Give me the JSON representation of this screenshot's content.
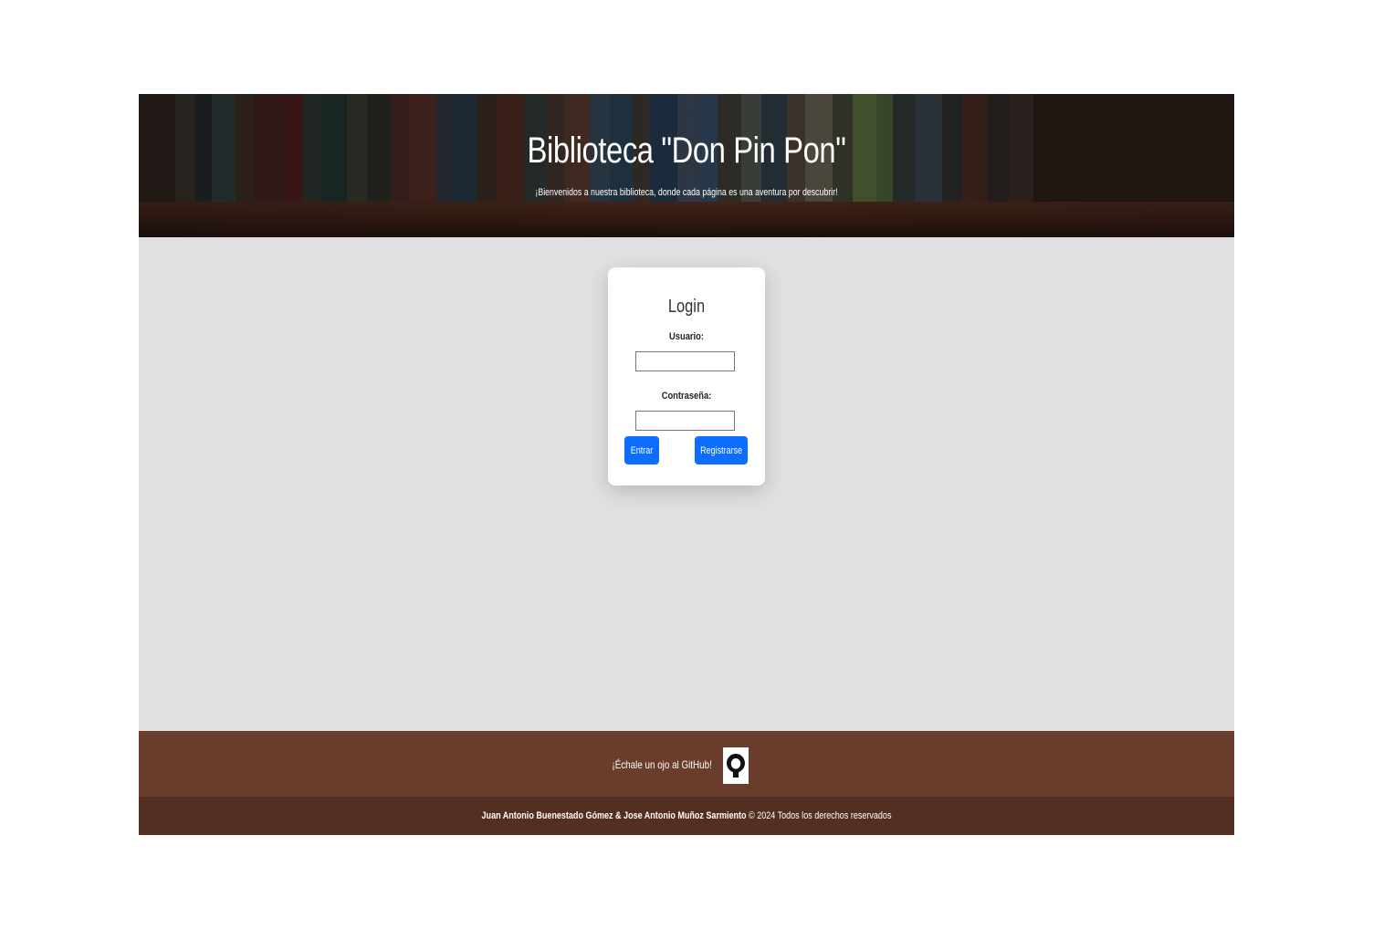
{
  "header": {
    "title": "Biblioteca \"Don Pin Pon\"",
    "subtitle": "¡Bienvenidos a nuestra biblioteca, donde cada página es una aventura por descubrir!"
  },
  "login": {
    "title": "Login",
    "username_label": "Usuario:",
    "username_value": "",
    "password_label": "Contraseña:",
    "password_value": "",
    "enter_button": "Entrar",
    "register_button": "Registrarse"
  },
  "footer": {
    "github_text": "¡Échale un ojo al GitHub!",
    "github_icon": "github-icon",
    "authors": "Juan Antonio Buenestado Gómez & Jose Antonio Muñoz Sarmiento",
    "copyright": "© 2024 Todos los derechos reservados"
  },
  "colors": {
    "main_bg": "#e0e0e0",
    "button": "#0d6efd",
    "footer_top": "#6a3c2b",
    "footer_bottom": "#532f22"
  }
}
